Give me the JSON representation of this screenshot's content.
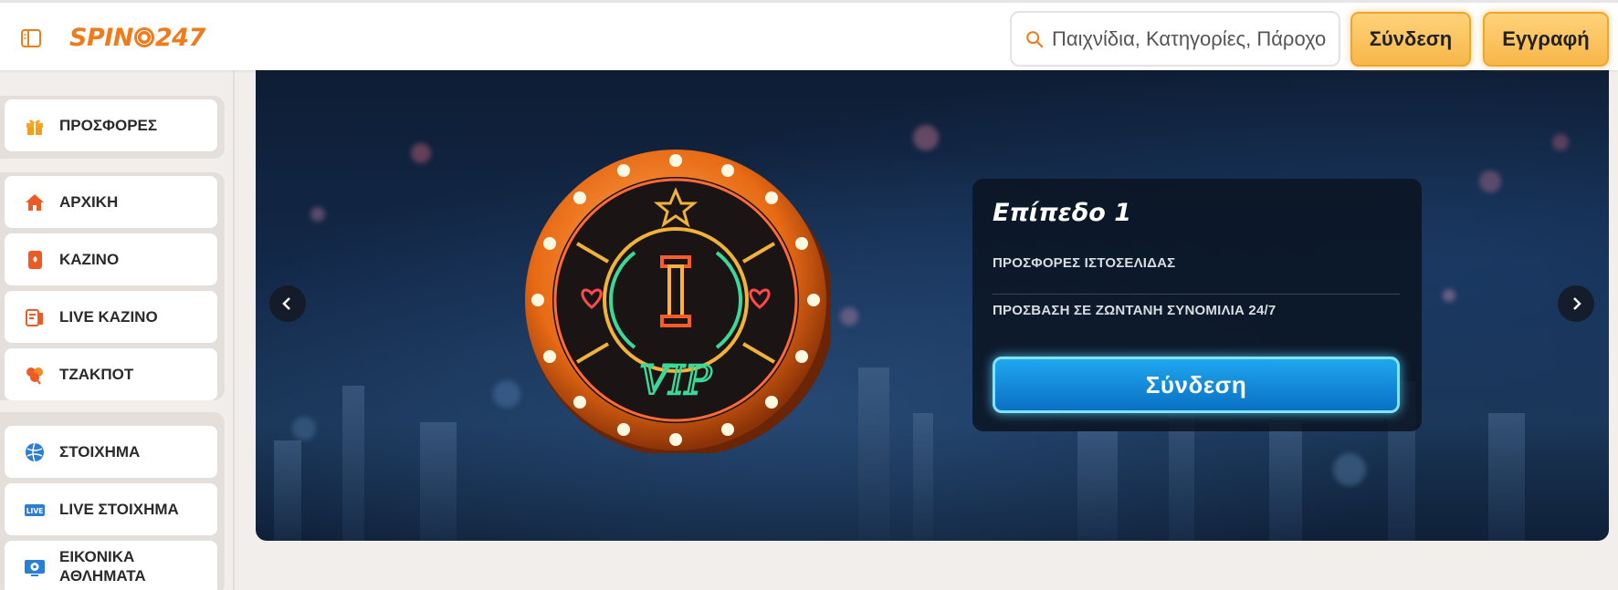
{
  "header": {
    "logo_text_left": "SPIN",
    "logo_text_right": "247",
    "search_placeholder": "Παιχνίδια, Κατηγορίες, Πάροχοι",
    "login_label": "Σύνδεση",
    "register_label": "Εγγραφή"
  },
  "sidebar": {
    "items": [
      {
        "label": "ΠΡΟΣΦΟΡΕΣ",
        "icon": "gift-icon"
      },
      {
        "label": "ΑΡΧΙΚΗ",
        "icon": "home-icon"
      },
      {
        "label": "ΚΑΖΙΝΟ",
        "icon": "cards-icon"
      },
      {
        "label": "LIVE ΚΑΖΙΝΟ",
        "icon": "live-casino-icon"
      },
      {
        "label": "ΤΖΑΚΠΟΤ",
        "icon": "clover-icon"
      },
      {
        "label": "ΣΤΟΙΧΗΜΑ",
        "icon": "ball-icon"
      },
      {
        "label": "LIVE ΣΤΟΙΧΗΜΑ",
        "icon": "live-badge-icon"
      },
      {
        "label": "ΕΙΚΟΝΙΚΑ ΑΘΛΗΜΑΤΑ",
        "icon": "virtual-sports-icon"
      }
    ]
  },
  "banner": {
    "chip_letter": "I",
    "chip_text": "VIP",
    "level_title": "Επίπεδο 1",
    "benefits": [
      "ΠΡΟΣΦΟΡΕΣ ΙΣΤΟΣΕΛΙΔΑΣ",
      "ΠΡΟΣΒΑΣΗ ΣΕ ΖΩΝΤΑΝΗ ΣΥΝΟΜΙΛΙΑ 24/7"
    ],
    "login_label": "Σύνδεση"
  },
  "colors": {
    "brand_orange": "#f07b1c",
    "header_button": "#f7b748",
    "card_button": "#0a70c4"
  }
}
